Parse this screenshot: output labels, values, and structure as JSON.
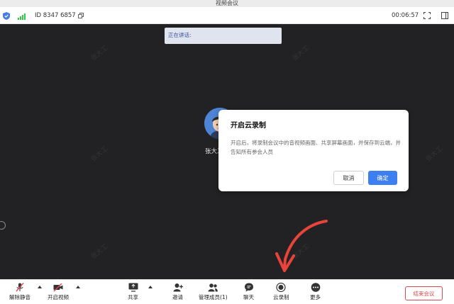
{
  "window": {
    "title": "视频会议"
  },
  "infobar": {
    "meeting_id": "ID 8347 6857",
    "timer": "00:06:57"
  },
  "stage": {
    "speaking_label": "正在讲话:",
    "participant_name": "张大工",
    "watermark_text": "张大工"
  },
  "dialog": {
    "title": "开启云录制",
    "body": "开启后，将录制会议中的音视频画面、共享屏幕画面，并保存到云端，并告知所有参会人员",
    "cancel_label": "取消",
    "confirm_label": "确定"
  },
  "toolbar": {
    "unmute_label": "解除静音",
    "video_label": "开启视频",
    "share_label": "共享",
    "invite_label": "邀请",
    "members_label": "管理成员(1)",
    "chat_label": "聊天",
    "record_label": "云录制",
    "more_label": "更多",
    "end_label": "结束会议"
  },
  "colors": {
    "accent": "#3d7ef0",
    "danger": "#e0474c",
    "signal": "#2ecc40",
    "annotation": "#e8443a"
  },
  "icons": [
    "shield-icon",
    "signal-icon",
    "copy-icon",
    "fullscreen-icon",
    "layout-icon",
    "mic-muted-icon",
    "camera-off-icon",
    "share-screen-icon",
    "add-user-icon",
    "members-icon",
    "chat-icon",
    "record-icon",
    "more-icon"
  ]
}
